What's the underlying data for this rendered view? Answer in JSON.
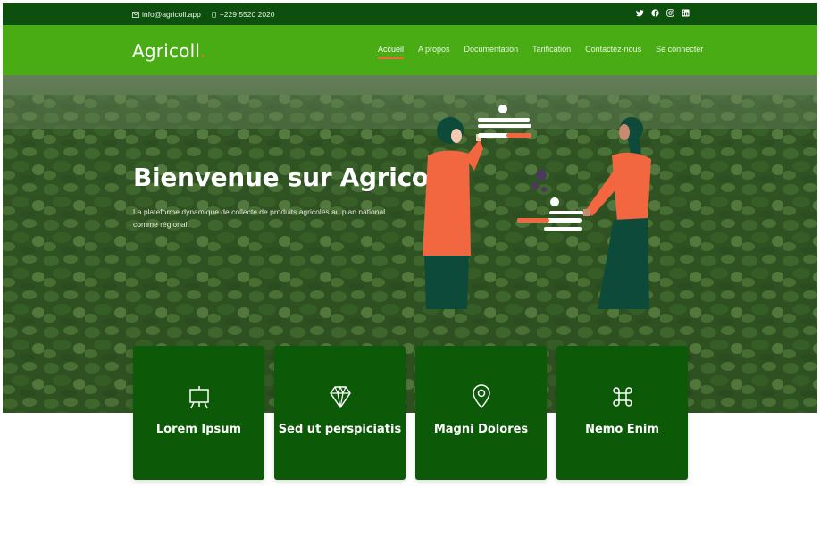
{
  "topbar": {
    "email": "info@agricoll.app",
    "phone": "+229 5520 2020",
    "social_icons": [
      "twitter-icon",
      "facebook-icon",
      "instagram-icon",
      "linkedin-icon"
    ]
  },
  "header": {
    "logo": "Agricoll",
    "logo_dot": ".",
    "nav": [
      {
        "label": "Accueil",
        "active": true
      },
      {
        "label": "A propos",
        "active": false
      },
      {
        "label": "Documentation",
        "active": false
      },
      {
        "label": "Tarification",
        "active": false
      },
      {
        "label": "Contactez-nous",
        "active": false
      },
      {
        "label": "Se connecter",
        "active": false
      }
    ]
  },
  "hero": {
    "title": "Bienvenue sur Agricoll",
    "subtitle": "La plateforme dynamique de collecte de produits agricoles au plan national comme régional."
  },
  "cards": [
    {
      "label": "Lorem Ipsum",
      "icon": "easel-icon"
    },
    {
      "label": "Sed ut perspiciatis",
      "icon": "gem-icon"
    },
    {
      "label": "Magni Dolores",
      "icon": "map-pin-icon"
    },
    {
      "label": "Nemo Enim",
      "icon": "command-icon"
    }
  ],
  "colors": {
    "topbar": "#0d4f0d",
    "header": "#4aac14",
    "accent": "#f06a35",
    "card": "#0c5a08"
  }
}
